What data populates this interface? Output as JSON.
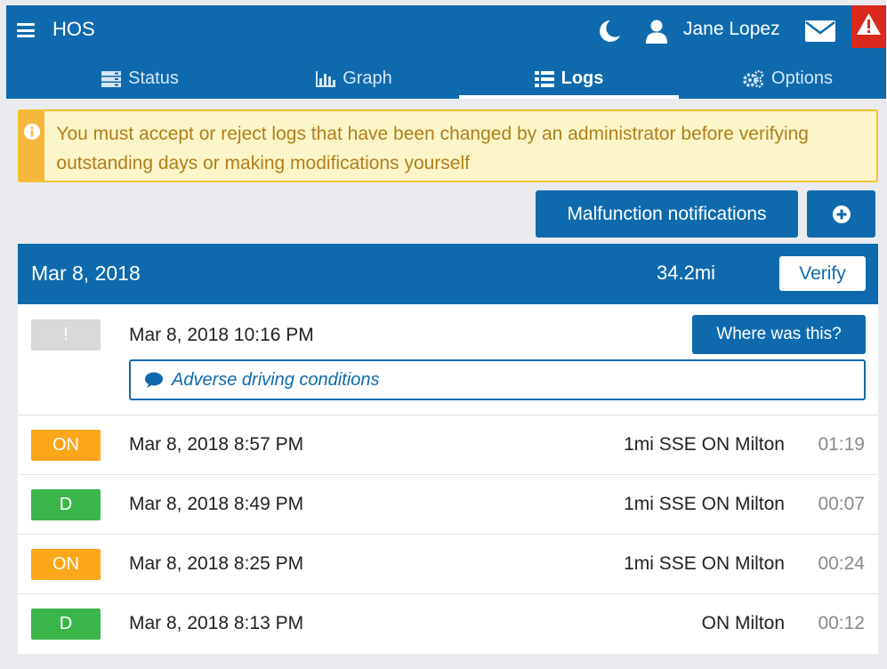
{
  "header": {
    "app_title": "HOS",
    "user_name": "Jane Lopez",
    "icons": [
      "menu-icon",
      "moon-icon",
      "user-icon",
      "mail-icon",
      "warning-triangle-icon"
    ],
    "accent_color": "#0f6aad",
    "alert_color": "#d9281d"
  },
  "tabs": [
    {
      "label": "Status",
      "icon": "status-icon"
    },
    {
      "label": "Graph",
      "icon": "bar-chart-icon"
    },
    {
      "label": "Logs",
      "icon": "list-icon",
      "active": true
    },
    {
      "label": "Options",
      "icon": "gears-icon"
    }
  ],
  "warning": {
    "text": "You must accept or reject logs that have been changed by an administrator before verifying outstanding days or making modifications yourself",
    "icon": "info-icon"
  },
  "actions": {
    "malfunction_label": "Malfunction notifications",
    "add_icon": "plus-circle-icon"
  },
  "day": {
    "date": "Mar 8, 2018",
    "distance": "34.2mi",
    "verify_label": "Verify"
  },
  "annotated_log": {
    "badge": "!",
    "time": "Mar 8, 2018 10:16 PM",
    "where_label": "Where was this?",
    "annotation": "Adverse driving conditions",
    "annotation_icon": "comment-icon"
  },
  "logs": [
    {
      "status": "ON",
      "time": "Mar 8, 2018 8:57 PM",
      "location": "1mi SSE ON Milton",
      "duration": "01:19",
      "color": "#fba61b"
    },
    {
      "status": "D",
      "time": "Mar 8, 2018 8:49 PM",
      "location": "1mi SSE ON Milton",
      "duration": "00:07",
      "color": "#3ab54a"
    },
    {
      "status": "ON",
      "time": "Mar 8, 2018 8:25 PM",
      "location": "1mi SSE ON Milton",
      "duration": "00:24",
      "color": "#fba61b"
    },
    {
      "status": "D",
      "time": "Mar 8, 2018 8:13 PM",
      "location": "ON Milton",
      "duration": "00:12",
      "color": "#3ab54a"
    }
  ]
}
